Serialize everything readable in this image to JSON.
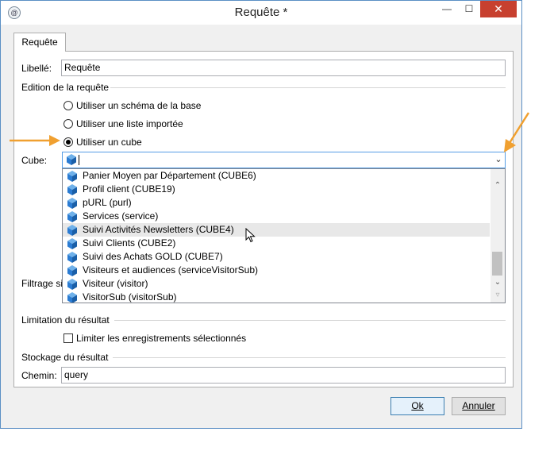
{
  "window": {
    "title": "Requête *"
  },
  "titlebar": {
    "min": "—",
    "max": "☐",
    "close": "✕"
  },
  "tabs": [
    {
      "label": "Requête"
    }
  ],
  "form": {
    "libelle_label": "Libellé:",
    "libelle_value": "Requête",
    "edition_section": "Edition de la requête",
    "radios": [
      {
        "label": "Utiliser un schéma de la base",
        "checked": false
      },
      {
        "label": "Utiliser une liste importée",
        "checked": false
      },
      {
        "label": "Utiliser un cube",
        "checked": true
      }
    ],
    "cube_label": "Cube:",
    "filtrage_label": "Filtrage si",
    "limitation_section": "Limitation du résultat",
    "limit_checkbox_label": "Limiter les enregistrements sélectionnés",
    "stockage_section": "Stockage du résultat",
    "chemin_label": "Chemin:",
    "chemin_value": "query"
  },
  "cube_dropdown": {
    "items": [
      "Panier Moyen par Département (CUBE6)",
      "Profil client (CUBE19)",
      "pURL (purl)",
      "Services (service)",
      "Suivi Activités Newsletters (CUBE4)",
      "Suivi Clients (CUBE2)",
      "Suivi des Achats GOLD (CUBE7)",
      "Visiteurs et audiences (serviceVisitorSub)",
      "Visiteur (visitor)",
      "VisitorSub (visitorSub)"
    ],
    "highlighted": "Suivi Activités Newsletters (CUBE4)",
    "icon": "cube-icon",
    "accent_color": "#2b7cd3"
  },
  "buttons": {
    "ok": "Ok",
    "cancel": "Annuler"
  },
  "annotation_color": "#f0a030"
}
